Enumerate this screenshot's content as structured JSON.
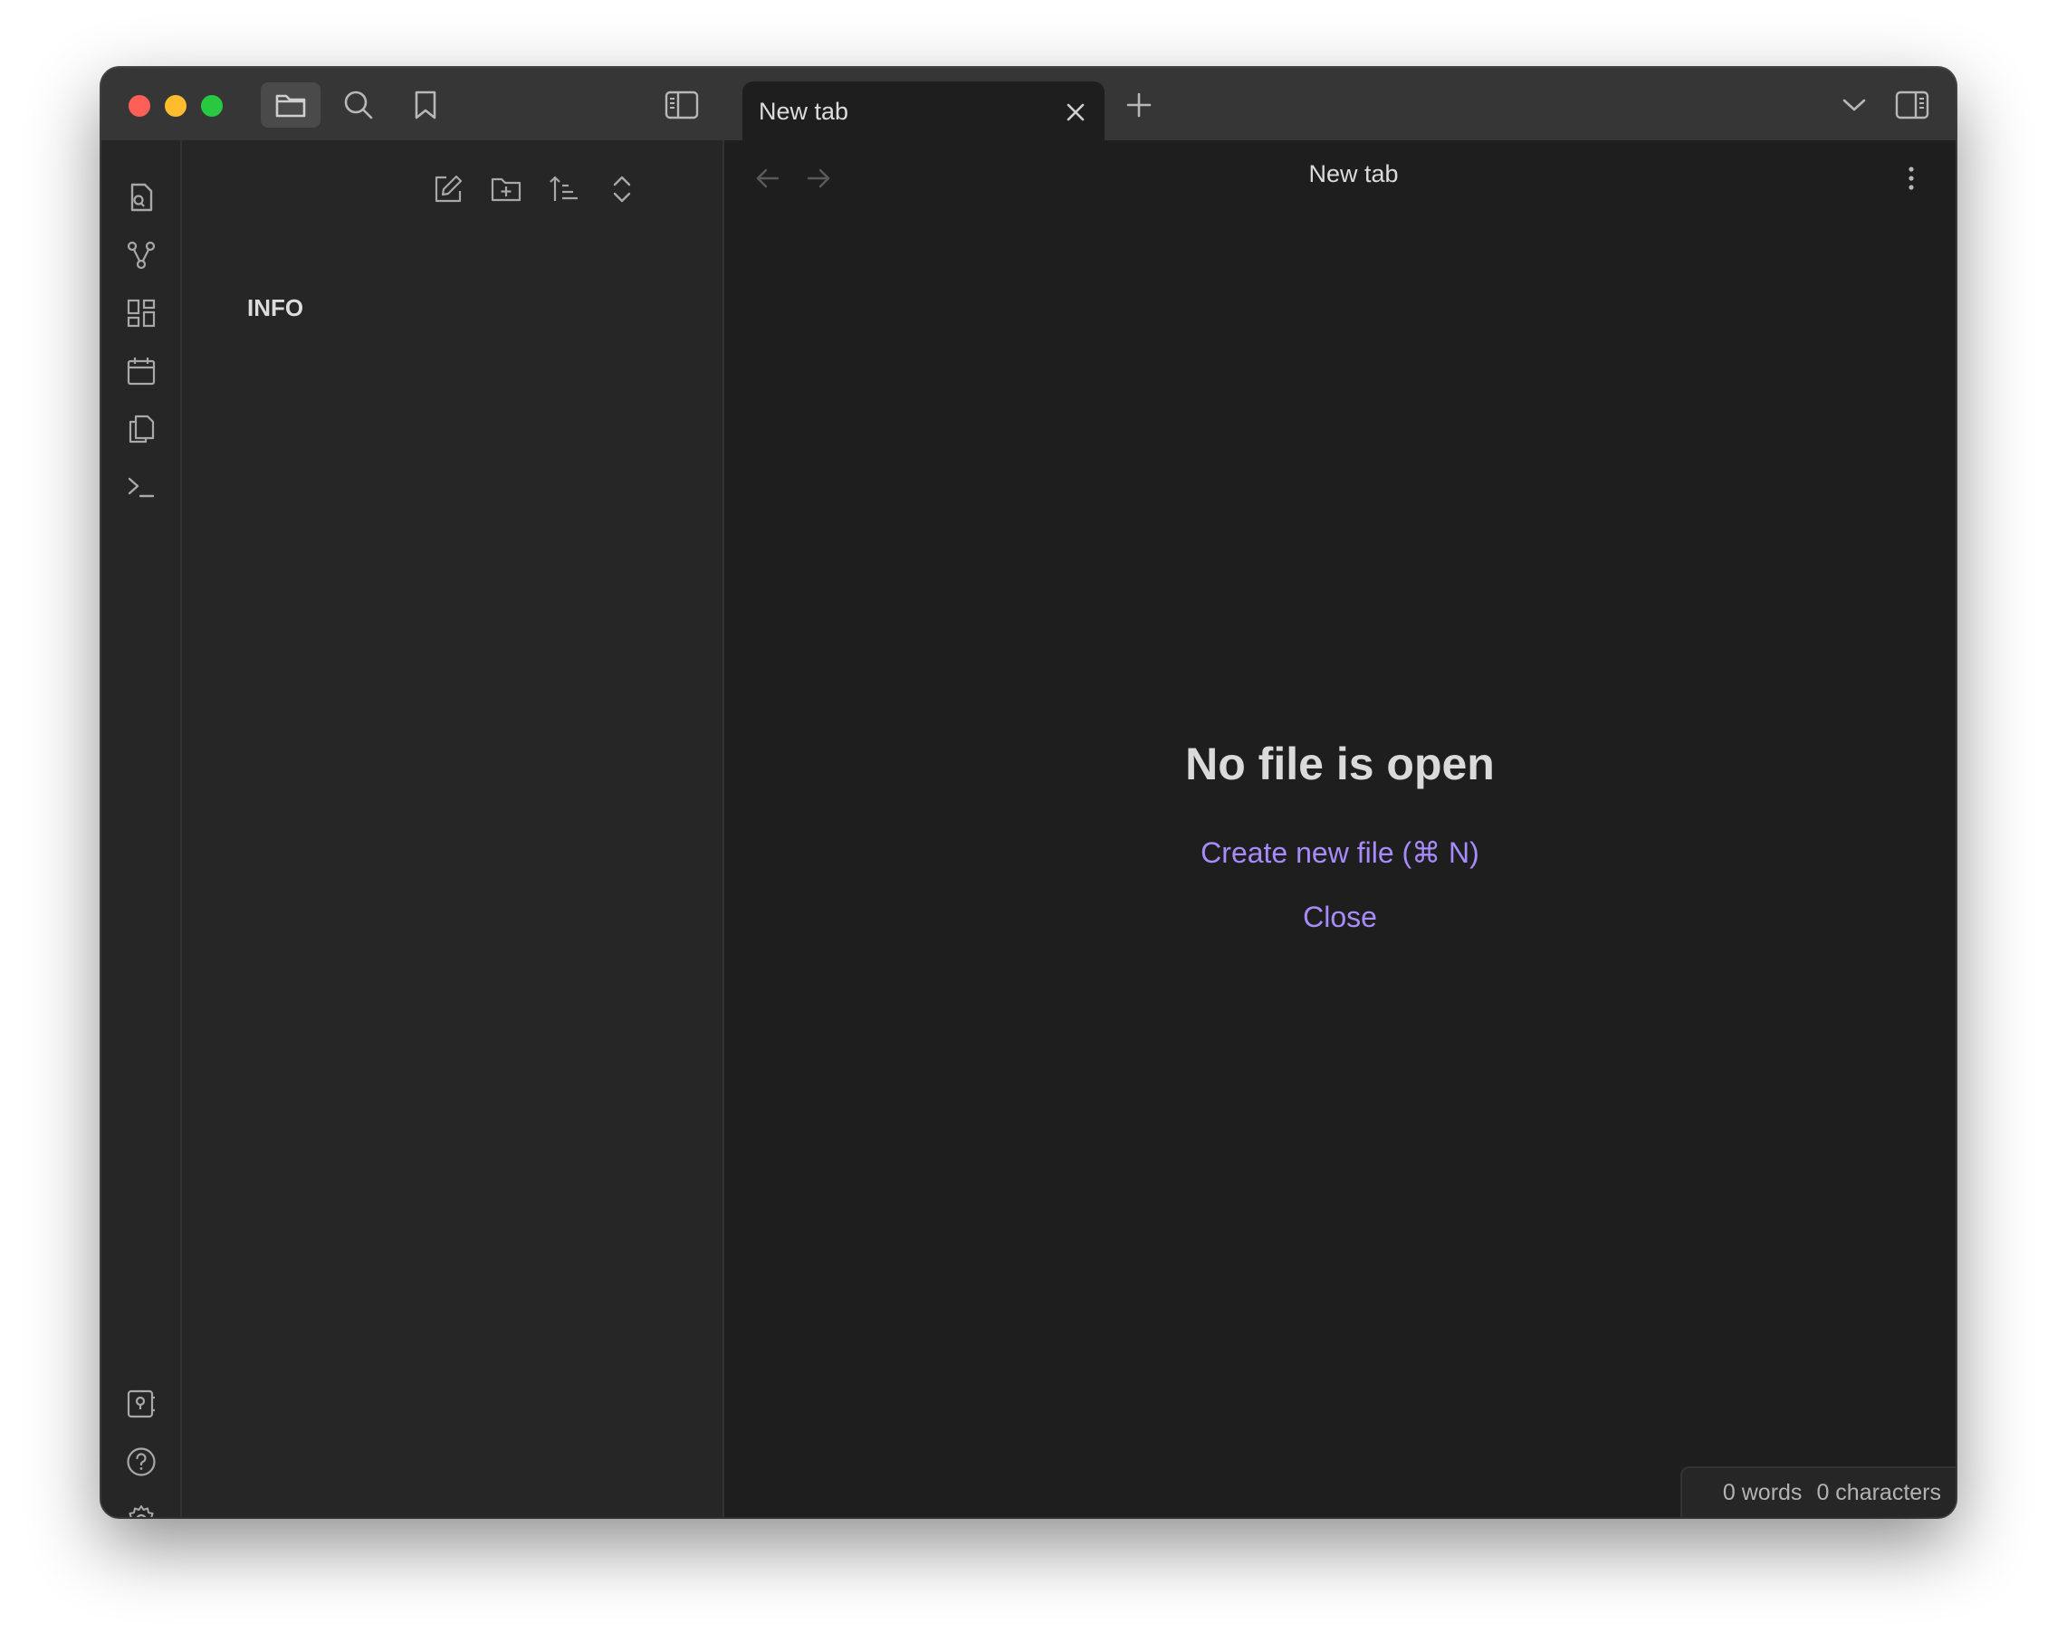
{
  "titlebar": {
    "tab_label": "New tab"
  },
  "sidebar": {
    "folder_label": "INFO"
  },
  "main": {
    "view_title": "New tab",
    "empty_title": "No file is open",
    "create_link": "Create new file (⌘ N)",
    "close_link": "Close"
  },
  "status": {
    "words": "0 words",
    "characters": "0 characters"
  },
  "colors": {
    "accent": "#a88bfa",
    "background": "#1e1e1e",
    "sidebar": "#262626",
    "titlebar": "#363636"
  },
  "icons": {
    "titlebar": [
      "folder-icon",
      "search-icon",
      "bookmark-icon",
      "sidebar-toggle-icon",
      "new-tab-icon",
      "chevron-down-icon",
      "right-sidebar-toggle-icon"
    ],
    "ribbon": [
      "file-search-icon",
      "graph-icon",
      "canvas-icon",
      "calendar-icon",
      "copy-icon",
      "terminal-icon",
      "vault-icon",
      "help-icon",
      "settings-icon"
    ],
    "sidebar_toolbar": [
      "new-note-icon",
      "new-folder-icon",
      "sort-icon",
      "collapse-icon"
    ]
  }
}
